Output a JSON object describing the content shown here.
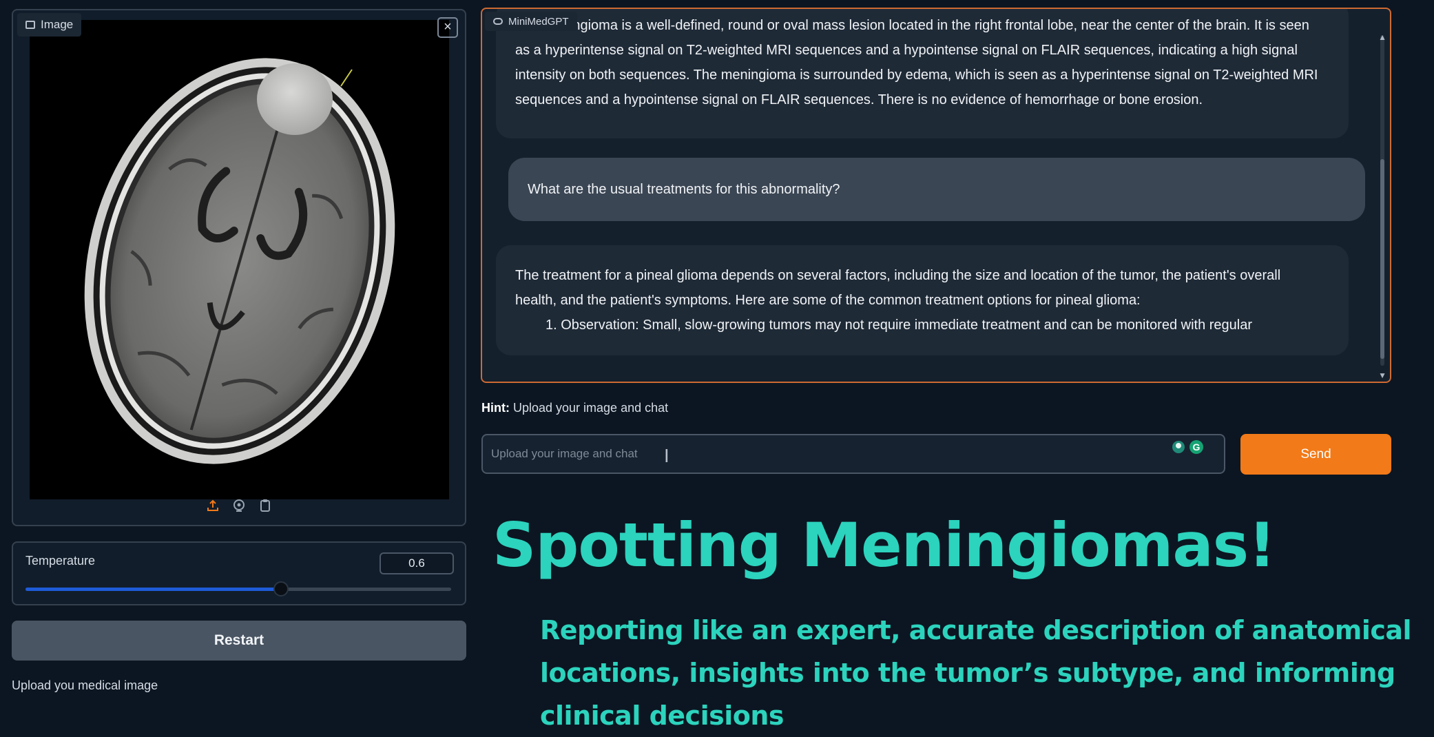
{
  "image_panel": {
    "label": "Image",
    "close_icon": "close-icon",
    "tools": [
      "upload-icon",
      "webcam-icon",
      "clipboard-icon"
    ]
  },
  "temperature": {
    "label": "Temperature",
    "value": "0.6",
    "slider_fraction": 0.6
  },
  "restart_label": "Restart",
  "upload_note": "Upload you medical image",
  "chat": {
    "label": "MiniMedGPT",
    "messages": [
      {
        "role": "assistant",
        "lines": [
          "The meningioma is a well-defined, round or oval mass lesion located in the right frontal lobe, near the center of the brain. It is seen",
          "as a hyperintense signal on T2-weighted MRI sequences and a hypointense signal on FLAIR sequences, indicating a high signal",
          "intensity on both sequences. The meningioma is surrounded by edema, which is seen as a hyperintense signal on T2-weighted MRI",
          "sequences and a hypointense signal on FLAIR sequences. There is no evidence of hemorrhage or bone erosion."
        ]
      },
      {
        "role": "user",
        "text": "What are the usual treatments for this abnormality?"
      },
      {
        "role": "assistant",
        "lines": [
          "The treatment for a pineal glioma depends on several factors, including the size and location of the tumor, the patient's overall",
          "health, and the patient's symptoms. Here are some of the common treatment options for pineal glioma:",
          "1. Observation: Small, slow-growing tumors may not require immediate treatment and can be monitored with regular"
        ]
      }
    ]
  },
  "hint": {
    "prefix": "Hint:",
    "text": " Upload your image and chat"
  },
  "input": {
    "placeholder": "Upload your image and chat",
    "value": ""
  },
  "send_label": "Send",
  "caption": {
    "title": "Spotting Meningiomas!",
    "subtitle": "Reporting like an expert, accurate description of anatomical locations, insights into the tumor’s subtype, and informing clinical decisions"
  },
  "colors": {
    "accent_orange": "#f27a18",
    "caption_teal": "#2cd3bd",
    "slider_blue": "#1e5bd7"
  }
}
